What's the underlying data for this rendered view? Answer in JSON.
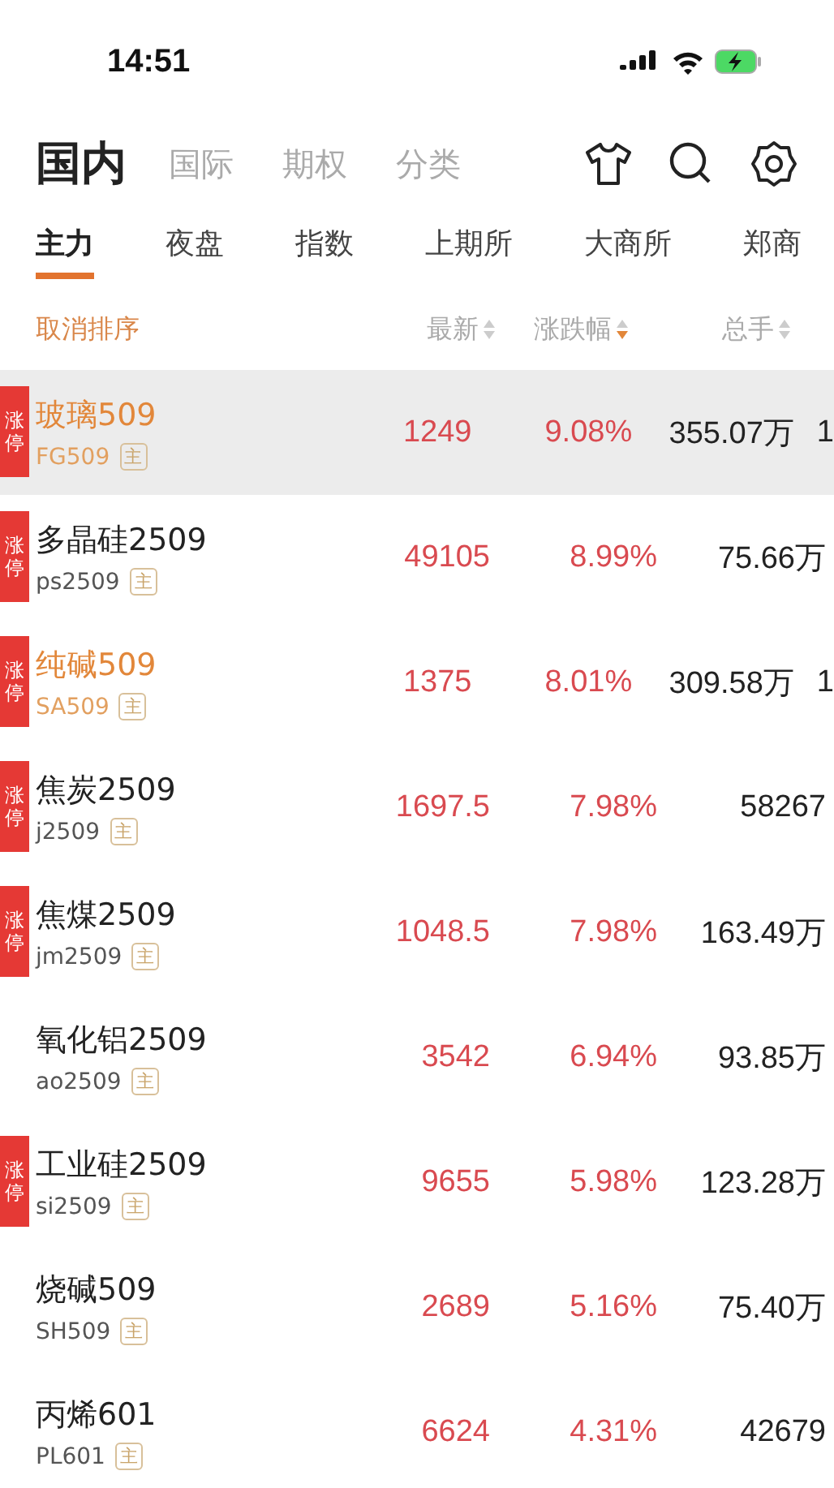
{
  "status_bar": {
    "time": "14:51"
  },
  "market_tabs": [
    {
      "label": "国内",
      "selected": true
    },
    {
      "label": "国际",
      "selected": false
    },
    {
      "label": "期权",
      "selected": false
    },
    {
      "label": "分类",
      "selected": false
    }
  ],
  "exchange_tabs": [
    {
      "label": "主力",
      "selected": true
    },
    {
      "label": "夜盘",
      "selected": false
    },
    {
      "label": "指数",
      "selected": false
    },
    {
      "label": "上期所",
      "selected": false
    },
    {
      "label": "大商所",
      "selected": false
    },
    {
      "label": "郑商",
      "selected": false
    }
  ],
  "sort_bar": {
    "cancel": "取消排序",
    "columns": [
      {
        "label": "最新",
        "sorted": false
      },
      {
        "label": "涨跌幅",
        "sorted": true
      },
      {
        "label": "总手",
        "sorted": false
      }
    ]
  },
  "rows": [
    {
      "name": "玻璃509",
      "code": "FG509",
      "badge": "主",
      "limit_up": true,
      "limit_label": "涨停",
      "highlighted": true,
      "selected": true,
      "price": "1249",
      "change": "9.08%",
      "volume": "355.07万",
      "column_5": "1"
    },
    {
      "name": "多晶硅2509",
      "code": "ps2509",
      "badge": "主",
      "limit_up": true,
      "limit_label": "涨停",
      "highlighted": false,
      "selected": false,
      "price": "49105",
      "change": "8.99%",
      "volume": "75.66万"
    },
    {
      "name": "纯碱509",
      "code": "SA509",
      "badge": "主",
      "limit_up": true,
      "limit_label": "涨停",
      "highlighted": true,
      "selected": false,
      "price": "1375",
      "change": "8.01%",
      "volume": "309.58万",
      "column_5": "1"
    },
    {
      "name": "焦炭2509",
      "code": "j2509",
      "badge": "主",
      "limit_up": true,
      "limit_label": "涨停",
      "highlighted": false,
      "selected": false,
      "price": "1697.5",
      "change": "7.98%",
      "volume": "58267"
    },
    {
      "name": "焦煤2509",
      "code": "jm2509",
      "badge": "主",
      "limit_up": true,
      "limit_label": "涨停",
      "highlighted": false,
      "selected": false,
      "price": "1048.5",
      "change": "7.98%",
      "volume": "163.49万"
    },
    {
      "name": "氧化铝2509",
      "code": "ao2509",
      "badge": "主",
      "limit_up": false,
      "highlighted": false,
      "selected": false,
      "price": "3542",
      "change": "6.94%",
      "volume": "93.85万"
    },
    {
      "name": "工业硅2509",
      "code": "si2509",
      "badge": "主",
      "limit_up": true,
      "limit_label": "涨停",
      "highlighted": false,
      "selected": false,
      "price": "9655",
      "change": "5.98%",
      "volume": "123.28万"
    },
    {
      "name": "烧碱509",
      "code": "SH509",
      "badge": "主",
      "limit_up": false,
      "highlighted": false,
      "selected": false,
      "price": "2689",
      "change": "5.16%",
      "volume": "75.40万"
    },
    {
      "name": "丙烯601",
      "code": "PL601",
      "badge": "主",
      "limit_up": false,
      "highlighted": false,
      "selected": false,
      "price": "6624",
      "change": "4.31%",
      "volume": "42679"
    }
  ]
}
